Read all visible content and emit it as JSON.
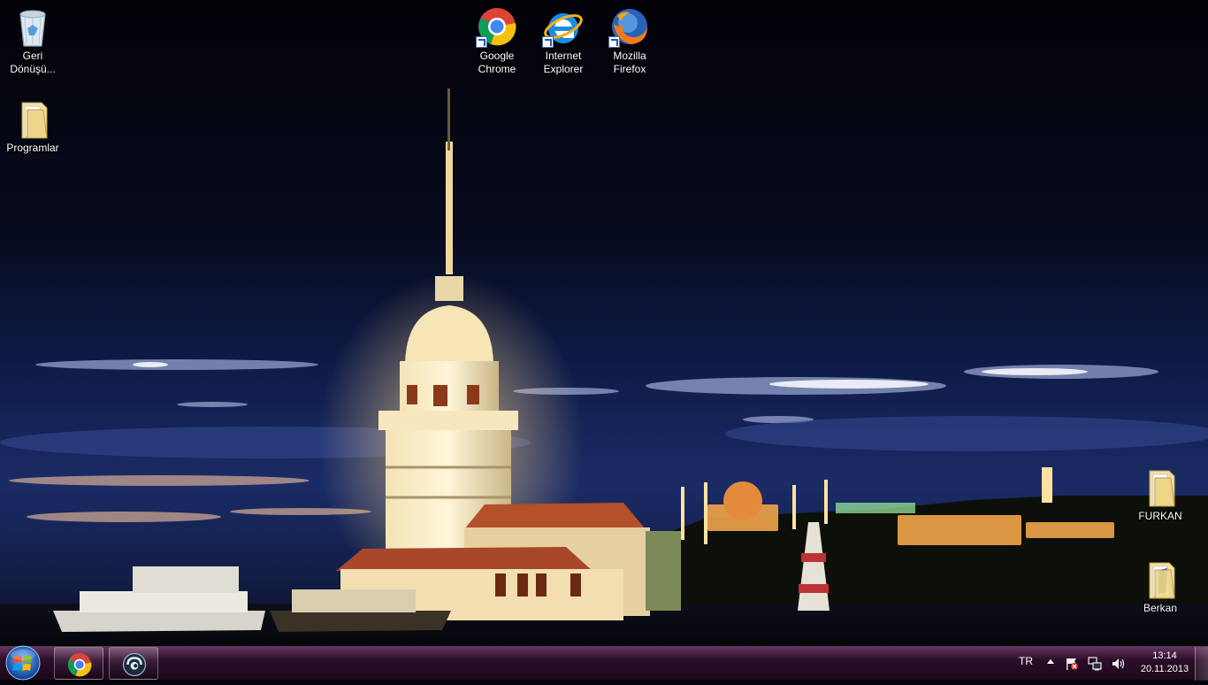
{
  "desktop": {
    "icons": [
      {
        "id": "recycle-bin",
        "label": "Geri Dönüşü..."
      },
      {
        "id": "programlar",
        "label": "Programlar"
      },
      {
        "id": "google-chrome",
        "label": "Google Chrome"
      },
      {
        "id": "internet-explorer",
        "label": "Internet Explorer"
      },
      {
        "id": "mozilla-firefox",
        "label": "Mozilla Firefox"
      },
      {
        "id": "furkan",
        "label": "FURKAN"
      },
      {
        "id": "berkan",
        "label": "Berkan"
      }
    ]
  },
  "taskbar": {
    "pinned": [
      {
        "icon": "chrome-icon",
        "active": true
      },
      {
        "icon": "teamspeak-icon",
        "active": false
      }
    ],
    "tray": {
      "language": "TR",
      "time": "13:14",
      "date": "20.11.2013"
    }
  },
  "colors": {
    "taskbar": "#2d0e2a",
    "sky": "#03040c",
    "accent": "#f6c66a"
  }
}
